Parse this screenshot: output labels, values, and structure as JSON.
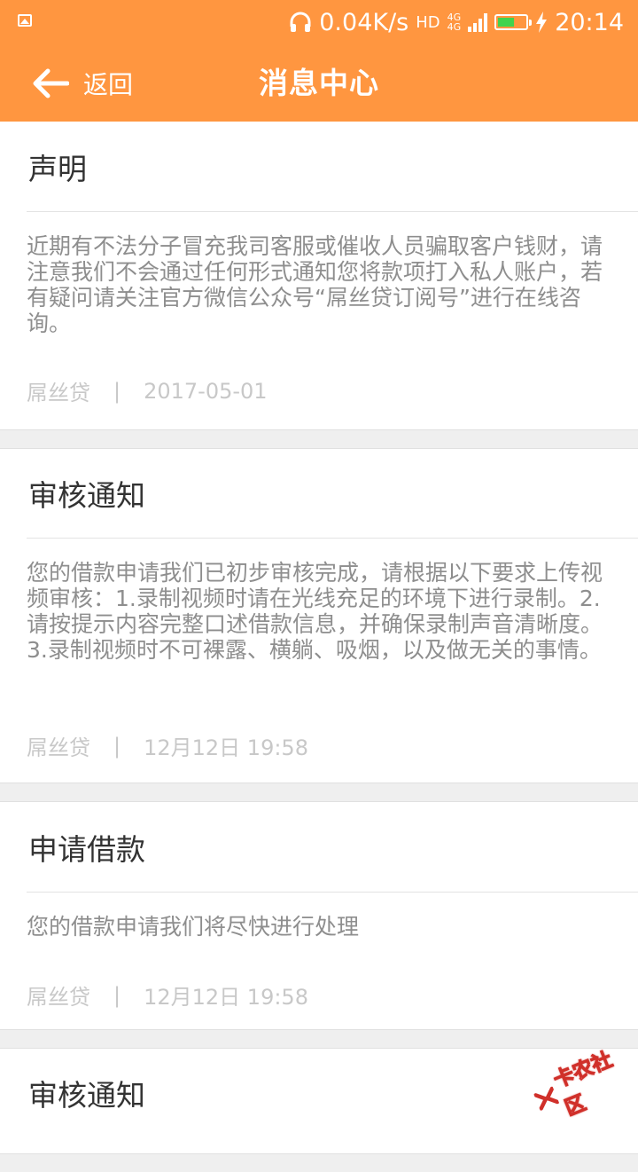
{
  "status_bar": {
    "speed": "0.04K/s",
    "hd": "HD",
    "network_top": "4G",
    "network_bottom": "4G",
    "time": "20:14",
    "colors": {
      "battery_fill": "#41d34e"
    }
  },
  "app_bar": {
    "back_label": "返回",
    "title": "消息中心",
    "background": "#ff9640"
  },
  "messages": [
    {
      "title": "声明",
      "body": "近期有不法分子冒充我司客服或催收人员骗取客户钱财，请注意我们不会通过任何形式通知您将款项打入私人账户，若有疑问请关注官方微信公众号“屌丝贷订阅号”进行在线咨询。",
      "source": "屌丝贷",
      "separator": "|",
      "date": "2017-05-01"
    },
    {
      "title": "审核通知",
      "body": "您的借款申请我们已初步审核完成，请根据以下要求上传视频审核：1.录制视频时请在光线充足的环境下进行录制。2.请按提示内容完整口述借款信息，并确保录制声音清晰度。3.录制视频时不可裸露、横躺、吸烟，以及做无关的事情。",
      "source": "屌丝贷",
      "separator": "|",
      "date": "12月12日 19:58"
    },
    {
      "title": "申请借款",
      "body": "您的借款申请我们将尽快进行处理",
      "source": "屌丝贷",
      "separator": "|",
      "date": "12月12日 19:58"
    },
    {
      "title": "审核通知"
    }
  ],
  "watermark": {
    "text": "卡农社区"
  }
}
